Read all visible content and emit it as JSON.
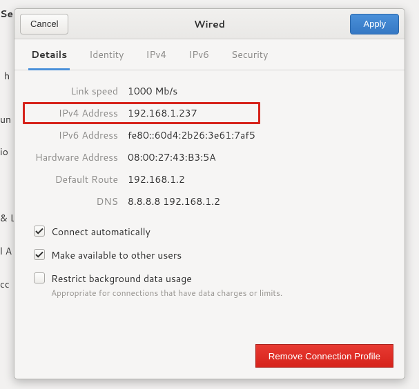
{
  "dialog": {
    "title": "Wired",
    "cancel_label": "Cancel",
    "apply_label": "Apply",
    "remove_label": "Remove Connection Profile"
  },
  "tabs": [
    {
      "label": "Details",
      "active": true
    },
    {
      "label": "Identity",
      "active": false
    },
    {
      "label": "IPv4",
      "active": false
    },
    {
      "label": "IPv6",
      "active": false
    },
    {
      "label": "Security",
      "active": false
    }
  ],
  "details": {
    "link_speed": {
      "label": "Link speed",
      "value": "1000 Mb/s"
    },
    "ipv4_address": {
      "label": "IPv4 Address",
      "value": "192.168.1.237"
    },
    "ipv6_address": {
      "label": "IPv6 Address",
      "value": "fe80::60d4:2b26:3e61:7af5"
    },
    "hardware_address": {
      "label": "Hardware Address",
      "value": "08:00:27:43:B3:5A"
    },
    "default_route": {
      "label": "Default Route",
      "value": "192.168.1.2"
    },
    "dns": {
      "label": "DNS",
      "value": "8.8.8.8 192.168.1.2"
    }
  },
  "options": {
    "connect_auto": {
      "label": "Connect automatically",
      "checked": true
    },
    "available_users": {
      "label": "Make available to other users",
      "checked": true
    },
    "restrict_bg": {
      "label": "Restrict background data usage",
      "sub": "Appropriate for connections that have data charges or limits.",
      "checked": false
    }
  },
  "backdrop_fragments": {
    "a": "Se",
    "b": "h",
    "c": "un",
    "d": "io",
    "e": "& L",
    "f": "l A",
    "g": "cc"
  }
}
